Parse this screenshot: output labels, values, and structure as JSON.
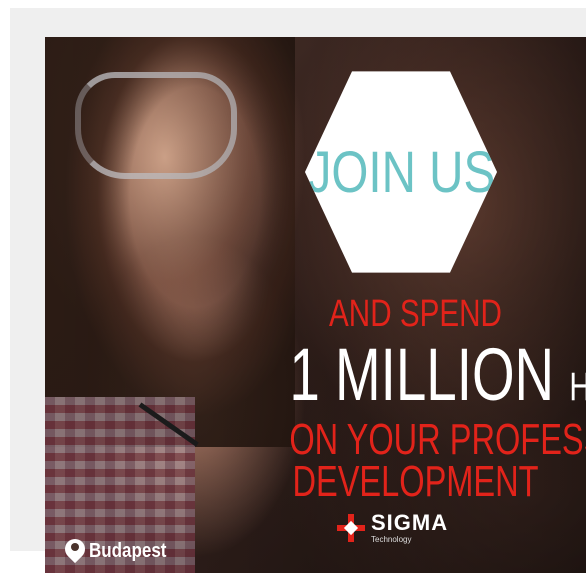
{
  "badge": {
    "title": "JOIN US"
  },
  "tagline": {
    "line1": "AND SPEND",
    "amount": "1 MILLION",
    "unit": "HUF",
    "line3": "ON YOUR PROFESSIONAL",
    "line4": "DEVELOPMENT"
  },
  "logo": {
    "name": "SIGMA",
    "sub": "Technology"
  },
  "location": {
    "label": "Budapest"
  },
  "colors": {
    "accent_red": "#e2231a",
    "teal": "#6cc3c5",
    "white": "#ffffff"
  },
  "icons": {
    "location": "map-pin-icon",
    "logo": "sigma-logo-icon"
  }
}
